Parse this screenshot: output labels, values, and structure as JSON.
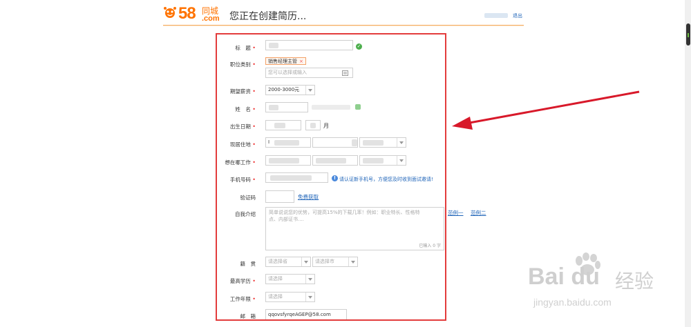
{
  "header": {
    "logo_58": "58",
    "logo_city": "同城",
    "logo_com": ".com",
    "title": "您正在创建简历...",
    "logout": "退出"
  },
  "form": {
    "title_label": "标　题",
    "job_category_label": "职位类别",
    "job_category_chip": "销售经理主管",
    "job_category_chip_remove": "×",
    "job_category_placeholder": "您可以选择或输入",
    "salary_label": "期望薪资",
    "salary_value": "2000-3000元",
    "name_label": "姓　名",
    "birth_label": "出生日期",
    "birth_month_unit": "月",
    "residence_label": "现居住地",
    "residence_value_prefix": "I",
    "work_place_label": "想在哪工作",
    "phone_label": "手机号码",
    "phone_hint": "请认证新手机号，方便您及时收到面试邀请!",
    "code_label": "验证码",
    "code_link": "免费获取",
    "intro_label": "自我介绍",
    "intro_placeholder": "简单说说您的优势，可提高15%的下载几率！例如：职业特长、性格特点、内部证书....",
    "intro_counter": "已输入 0 字",
    "example1": "范例一",
    "example2": "范例二",
    "native_label": "籍　贯",
    "native_province_placeholder": "请选择省",
    "native_city_placeholder": "请选择市",
    "education_label": "最高学历",
    "education_placeholder": "请选择",
    "work_years_label": "工作年限",
    "work_years_placeholder": "请选择",
    "email_label": "邮　箱",
    "email_value": "qqovsfyrqeAGEP@58.com",
    "required_mark": "•"
  },
  "icons": {
    "check": "check-circle-icon",
    "info": "info-circle-icon",
    "calendar": "calendar-icon",
    "logo": "58-logo-icon"
  },
  "colors": {
    "brand": "#ff7300",
    "highlight": "#e33b3b",
    "link": "#1d63b8",
    "arrow": "#d8192a"
  },
  "watermark": {
    "brand": "Bai du",
    "brand_cn": "经验",
    "url": "jingyan.baidu.com"
  }
}
